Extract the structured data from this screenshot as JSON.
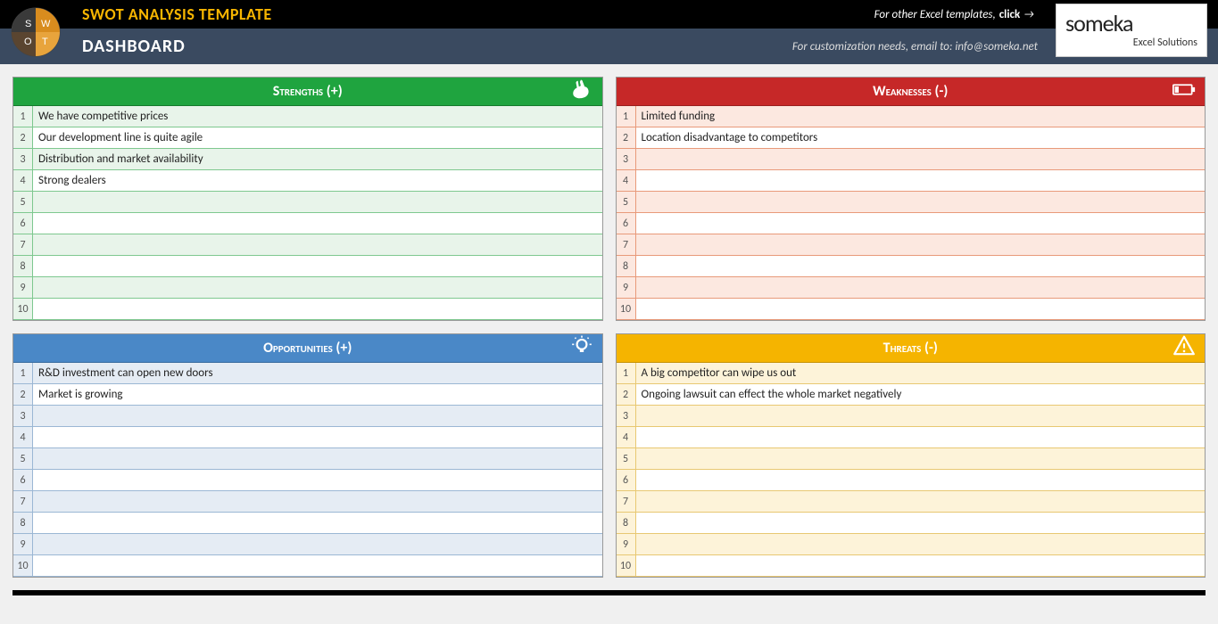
{
  "header": {
    "title": "SWOT ANALYSIS TEMPLATE",
    "subtitle": "DASHBOARD",
    "templates_prompt": "For other Excel templates, ",
    "templates_link": "click",
    "customization_text": "For customization needs, email to: info@someka.net",
    "logo_brand": "someka",
    "logo_sub": "Excel Solutions"
  },
  "panels": {
    "strengths": {
      "title": "Strengths (+)",
      "rows": [
        "We have competitive prices",
        "Our development line is quite agile",
        "Distribution and market availability",
        "Strong dealers",
        "",
        "",
        "",
        "",
        "",
        ""
      ]
    },
    "weaknesses": {
      "title": "Weaknesses (-)",
      "rows": [
        "Limited funding",
        "Location disadvantage to competitors",
        "",
        "",
        "",
        "",
        "",
        "",
        "",
        ""
      ]
    },
    "opportunities": {
      "title": "Opportunities (+)",
      "rows": [
        "R&D investment can open new doors",
        "Market is growing",
        "",
        "",
        "",
        "",
        "",
        "",
        "",
        ""
      ]
    },
    "threats": {
      "title": "Threats (-)",
      "rows": [
        "A big competitor can wipe us out",
        "Ongoing lawsuit can effect the whole market negatively",
        "",
        "",
        "",
        "",
        "",
        "",
        "",
        ""
      ]
    }
  },
  "nums": [
    "1",
    "2",
    "3",
    "4",
    "5",
    "6",
    "7",
    "8",
    "9",
    "10"
  ]
}
